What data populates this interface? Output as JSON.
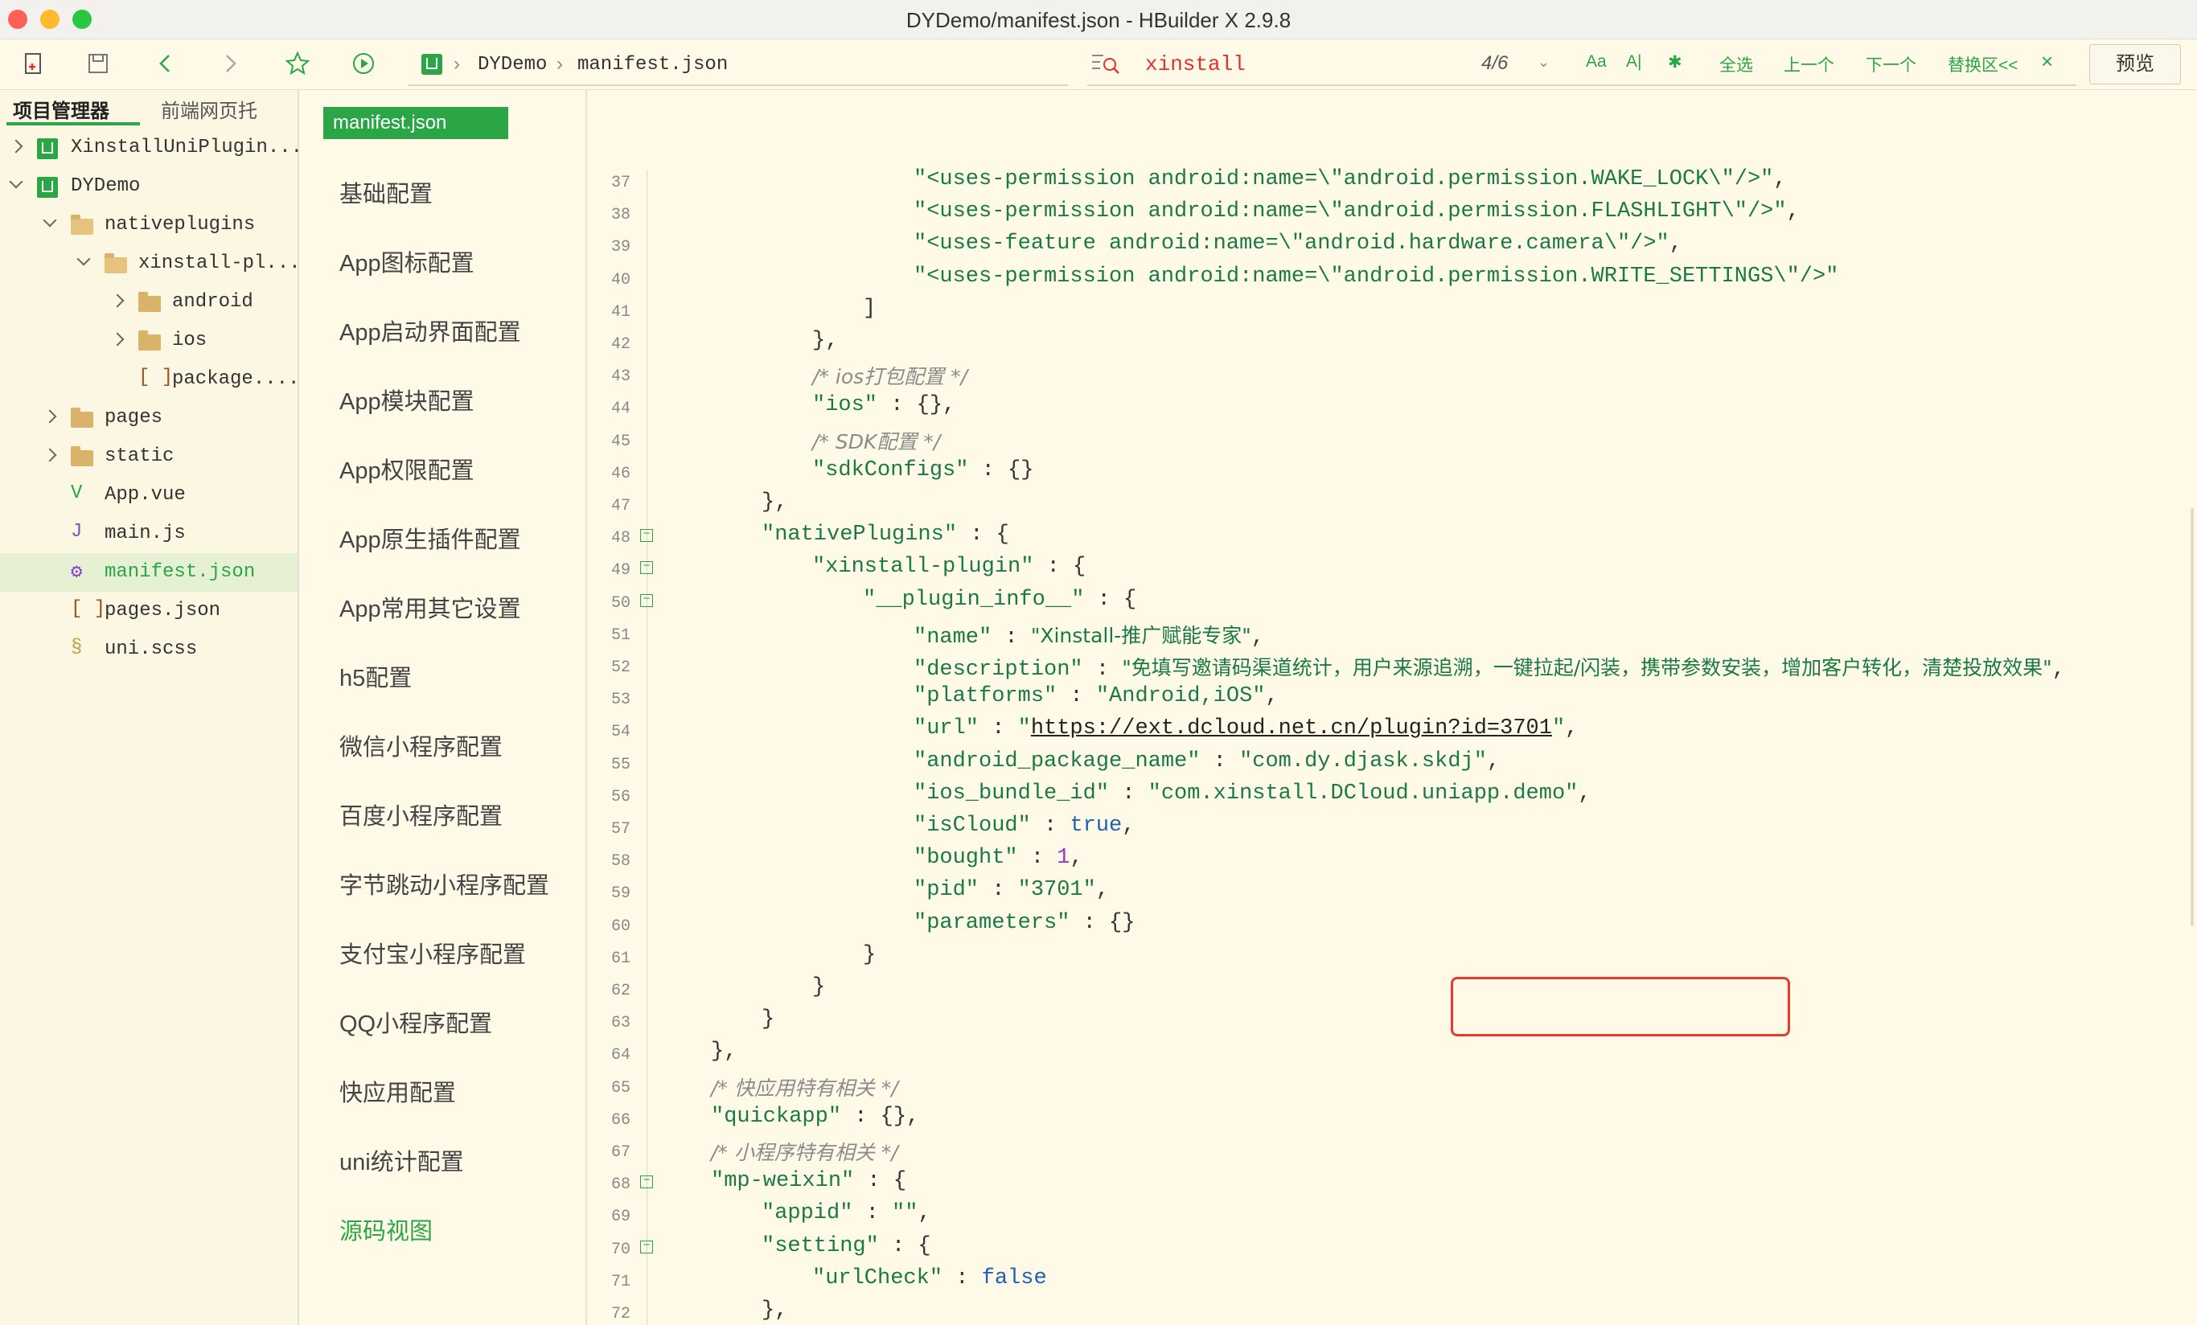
{
  "window": {
    "title": "DYDemo/manifest.json - HBuilder X 2.9.8"
  },
  "toolbar": {
    "breadcrumb": {
      "project": "DYDemo",
      "file": "manifest.json",
      "separator": "›"
    },
    "search": {
      "value": "xinstall",
      "count": "4/6",
      "case_label": "Aa",
      "regex_label": "A|",
      "select_all": "全选",
      "prev": "上一个",
      "next": "下一个",
      "replace": "替换区<<",
      "close": "×"
    },
    "preview_label": "预览"
  },
  "panel": {
    "tabs": {
      "project": "项目管理器",
      "web": "前端网页托"
    },
    "tree": [
      {
        "label": "XinstallUniPlugin...",
        "type": "project",
        "depth": 0,
        "expanded": false
      },
      {
        "label": "DYDemo",
        "type": "project",
        "depth": 0,
        "expanded": true
      },
      {
        "label": "nativeplugins",
        "type": "folder",
        "depth": 1,
        "expanded": true
      },
      {
        "label": "xinstall-pl...",
        "type": "folder",
        "depth": 2,
        "expanded": true
      },
      {
        "label": "android",
        "type": "folder",
        "depth": 3,
        "expanded": false
      },
      {
        "label": "ios",
        "type": "folder",
        "depth": 3,
        "expanded": false
      },
      {
        "label": "package....",
        "type": "json",
        "depth": 3,
        "expanded": null
      },
      {
        "label": "pages",
        "type": "folder",
        "depth": 1,
        "expanded": false
      },
      {
        "label": "static",
        "type": "folder",
        "depth": 1,
        "expanded": false
      },
      {
        "label": "App.vue",
        "type": "vue",
        "depth": 1,
        "expanded": null
      },
      {
        "label": "main.js",
        "type": "js",
        "depth": 1,
        "expanded": null
      },
      {
        "label": "manifest.json",
        "type": "manifest",
        "depth": 1,
        "expanded": null,
        "selected": true
      },
      {
        "label": "pages.json",
        "type": "json",
        "depth": 1,
        "expanded": null
      },
      {
        "label": "uni.scss",
        "type": "scss",
        "depth": 1,
        "expanded": null
      }
    ]
  },
  "editor": {
    "tab_label": "manifest.json",
    "nav": [
      "基础配置",
      "App图标配置",
      "App启动界面配置",
      "App模块配置",
      "App权限配置",
      "App原生插件配置",
      "App常用其它设置",
      "h5配置",
      "微信小程序配置",
      "百度小程序配置",
      "字节跳动小程序配置",
      "支付宝小程序配置",
      "QQ小程序配置",
      "快应用配置",
      "uni统计配置",
      "源码视图"
    ],
    "lines": [
      {
        "n": "37",
        "fold": false,
        "ind": 4,
        "parts": [
          [
            "str",
            "\"<uses-permission android:name=\\\"android.permission.WAKE_LOCK\\\"/>\""
          ],
          [
            "p",
            ","
          ]
        ]
      },
      {
        "n": "38",
        "fold": false,
        "ind": 4,
        "parts": [
          [
            "str",
            "\"<uses-permission android:name=\\\"android.permission.FLASHLIGHT\\\"/>\""
          ],
          [
            "p",
            ","
          ]
        ]
      },
      {
        "n": "39",
        "fold": false,
        "ind": 4,
        "parts": [
          [
            "str",
            "\"<uses-feature android:name=\\\"android.hardware.camera\\\"/>\""
          ],
          [
            "p",
            ","
          ]
        ]
      },
      {
        "n": "40",
        "fold": false,
        "ind": 4,
        "parts": [
          [
            "str",
            "\"<uses-permission android:name=\\\"android.permission.WRITE_SETTINGS\\\"/>\""
          ]
        ]
      },
      {
        "n": "41",
        "fold": false,
        "ind": 3,
        "parts": [
          [
            "p",
            "]"
          ]
        ]
      },
      {
        "n": "42",
        "fold": false,
        "ind": 2,
        "parts": [
          [
            "p",
            "},"
          ]
        ]
      },
      {
        "n": "43",
        "fold": false,
        "ind": 2,
        "parts": [
          [
            "cmt",
            "/* ios打包配置 */"
          ]
        ]
      },
      {
        "n": "44",
        "fold": false,
        "ind": 2,
        "parts": [
          [
            "key",
            "\"ios\""
          ],
          [
            "p",
            " : {},"
          ]
        ]
      },
      {
        "n": "45",
        "fold": false,
        "ind": 2,
        "parts": [
          [
            "cmt",
            "/* SDK配置 */"
          ]
        ]
      },
      {
        "n": "46",
        "fold": false,
        "ind": 2,
        "parts": [
          [
            "key",
            "\"sdkConfigs\""
          ],
          [
            "p",
            " : {}"
          ]
        ]
      },
      {
        "n": "47",
        "fold": false,
        "ind": 1,
        "parts": [
          [
            "p",
            "},"
          ]
        ]
      },
      {
        "n": "48",
        "fold": true,
        "ind": 1,
        "parts": [
          [
            "key",
            "\"nativePlugins\""
          ],
          [
            "p",
            " : {"
          ]
        ]
      },
      {
        "n": "49",
        "fold": true,
        "ind": 2,
        "parts": [
          [
            "key",
            "\"xinstall-plugin\""
          ],
          [
            "p",
            " : {"
          ]
        ]
      },
      {
        "n": "50",
        "fold": true,
        "ind": 3,
        "parts": [
          [
            "key",
            "\"__plugin_info__\""
          ],
          [
            "p",
            " : {"
          ]
        ]
      },
      {
        "n": "51",
        "fold": false,
        "ind": 4,
        "parts": [
          [
            "key",
            "\"name\""
          ],
          [
            "p",
            " : "
          ],
          [
            "str",
            "\"Xinstall-推广赋能专家\""
          ],
          [
            "p",
            ","
          ]
        ]
      },
      {
        "n": "52",
        "fold": false,
        "ind": 4,
        "parts": [
          [
            "key",
            "\"description\""
          ],
          [
            "p",
            " : "
          ],
          [
            "str",
            "\"免填写邀请码渠道统计，用户来源追溯，一键拉起/闪装，携带参数安装，增加客户转化，清楚投放效果\""
          ],
          [
            "p",
            ","
          ]
        ]
      },
      {
        "n": "53",
        "fold": false,
        "ind": 4,
        "parts": [
          [
            "key",
            "\"platforms\""
          ],
          [
            "p",
            " : "
          ],
          [
            "str",
            "\"Android,iOS\""
          ],
          [
            "p",
            ","
          ]
        ]
      },
      {
        "n": "54",
        "fold": false,
        "ind": 4,
        "parts": [
          [
            "key",
            "\"url\""
          ],
          [
            "p",
            " : "
          ],
          [
            "str",
            "\""
          ],
          [
            "url",
            "https://ext.dcloud.net.cn/plugin?id=3701"
          ],
          [
            "str",
            "\""
          ],
          [
            "p",
            ","
          ]
        ]
      },
      {
        "n": "55",
        "fold": false,
        "ind": 4,
        "parts": [
          [
            "key",
            "\"android_package_name\""
          ],
          [
            "p",
            " : "
          ],
          [
            "str",
            "\"com.dy.djask.skdj\""
          ],
          [
            "p",
            ","
          ]
        ]
      },
      {
        "n": "56",
        "fold": false,
        "ind": 4,
        "parts": [
          [
            "key",
            "\"ios_bundle_id\""
          ],
          [
            "p",
            " : "
          ],
          [
            "str",
            "\"com.xinstall.DCloud.uniapp.demo\""
          ],
          [
            "p",
            ","
          ]
        ]
      },
      {
        "n": "57",
        "fold": false,
        "ind": 4,
        "parts": [
          [
            "key",
            "\"isCloud\""
          ],
          [
            "p",
            " : "
          ],
          [
            "bool",
            "true"
          ],
          [
            "p",
            ","
          ]
        ]
      },
      {
        "n": "58",
        "fold": false,
        "ind": 4,
        "parts": [
          [
            "key",
            "\"bought\""
          ],
          [
            "p",
            " : "
          ],
          [
            "num",
            "1"
          ],
          [
            "p",
            ","
          ]
        ]
      },
      {
        "n": "59",
        "fold": false,
        "ind": 4,
        "parts": [
          [
            "key",
            "\"pid\""
          ],
          [
            "p",
            " : "
          ],
          [
            "str",
            "\"3701\""
          ],
          [
            "p",
            ","
          ]
        ]
      },
      {
        "n": "60",
        "fold": false,
        "ind": 4,
        "parts": [
          [
            "key",
            "\"parameters\""
          ],
          [
            "p",
            " : {}"
          ]
        ]
      },
      {
        "n": "61",
        "fold": false,
        "ind": 3,
        "parts": [
          [
            "p",
            "}"
          ]
        ]
      },
      {
        "n": "62",
        "fold": false,
        "ind": 2,
        "parts": [
          [
            "p",
            "}"
          ]
        ]
      },
      {
        "n": "63",
        "fold": false,
        "ind": 1,
        "parts": [
          [
            "p",
            "}"
          ]
        ]
      },
      {
        "n": "64",
        "fold": false,
        "ind": 0,
        "parts": [
          [
            "p",
            "},"
          ]
        ]
      },
      {
        "n": "65",
        "fold": false,
        "ind": 0,
        "parts": [
          [
            "cmt",
            "/* 快应用特有相关 */"
          ]
        ]
      },
      {
        "n": "66",
        "fold": false,
        "ind": 0,
        "parts": [
          [
            "key",
            "\"quickapp\""
          ],
          [
            "p",
            " : {},"
          ]
        ]
      },
      {
        "n": "67",
        "fold": false,
        "ind": 0,
        "parts": [
          [
            "cmt",
            "/* 小程序特有相关 */"
          ]
        ]
      },
      {
        "n": "68",
        "fold": true,
        "ind": 0,
        "parts": [
          [
            "key",
            "\"mp-weixin\""
          ],
          [
            "p",
            " : {"
          ]
        ]
      },
      {
        "n": "69",
        "fold": false,
        "ind": 1,
        "parts": [
          [
            "key",
            "\"appid\""
          ],
          [
            "p",
            " : "
          ],
          [
            "str",
            "\"\""
          ],
          [
            "p",
            ","
          ]
        ]
      },
      {
        "n": "70",
        "fold": true,
        "ind": 1,
        "parts": [
          [
            "key",
            "\"setting\""
          ],
          [
            "p",
            " : {"
          ]
        ]
      },
      {
        "n": "71",
        "fold": false,
        "ind": 2,
        "parts": [
          [
            "key",
            "\"urlCheck\""
          ],
          [
            "p",
            " : "
          ],
          [
            "bool",
            "false"
          ]
        ]
      },
      {
        "n": "72",
        "fold": false,
        "ind": 1,
        "parts": [
          [
            "p",
            "},"
          ]
        ]
      }
    ]
  },
  "colors": {
    "accent": "#2aa646",
    "search_text": "#e0312a",
    "highlight_box": "#e53a2d",
    "background": "#fffae8"
  }
}
